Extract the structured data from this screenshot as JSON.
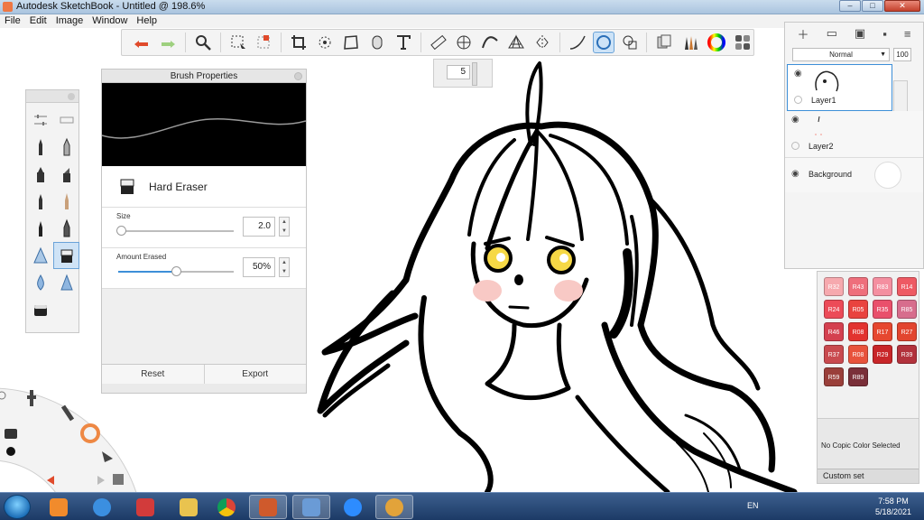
{
  "window": {
    "title": "Autodesk SketchBook - Untitled @ 198.6%",
    "min": "–",
    "max": "□",
    "close": "✕"
  },
  "menu": [
    "File",
    "Edit",
    "Image",
    "Window",
    "Help"
  ],
  "toolbar": {
    "tools": [
      "undo-icon",
      "redo-icon",
      "zoom-icon",
      "select-icon",
      "lasso-icon",
      "crop-icon",
      "transform-icon",
      "distort-icon",
      "fill-icon",
      "text-icon",
      "ruler-icon",
      "ellipse-icon",
      "curve-icon",
      "perspective-icon",
      "symmetry-icon",
      "stroke-icon",
      "predictive-icon",
      "shape-icon",
      "copy-icon",
      "brushes-icon",
      "color-wheel-icon",
      "palettes-icon"
    ],
    "active_tool": "predictive-icon"
  },
  "size_popup": {
    "value": "5"
  },
  "brush_properties": {
    "title": "Brush Properties",
    "brush_name": "Hard Eraser",
    "size": {
      "label": "Size",
      "value": "2.0",
      "fraction": 0.02
    },
    "amount": {
      "label": "Amount Erased",
      "value": "50%",
      "fraction": 0.5
    },
    "reset_label": "Reset",
    "export_label": "Export"
  },
  "layers": {
    "blend_mode": "Normal",
    "opacity": "100",
    "items": [
      {
        "name": "Layer1",
        "selected": true
      },
      {
        "name": "Layer2",
        "selected": false
      }
    ],
    "background_label": "Background"
  },
  "copic": {
    "swatches": [
      {
        "code": "R32",
        "color": "#f6a9ae"
      },
      {
        "code": "R43",
        "color": "#ee6f7c"
      },
      {
        "code": "R83",
        "color": "#f48fa0"
      },
      {
        "code": "R14",
        "color": "#ee5a63"
      },
      {
        "code": "R24",
        "color": "#ec4b58"
      },
      {
        "code": "R05",
        "color": "#e9433f"
      },
      {
        "code": "R35",
        "color": "#e9506b"
      },
      {
        "code": "R85",
        "color": "#d76d8d"
      },
      {
        "code": "R46",
        "color": "#d4404f"
      },
      {
        "code": "R08",
        "color": "#e2332f"
      },
      {
        "code": "R17",
        "color": "#e6472f"
      },
      {
        "code": "R27",
        "color": "#e2452f"
      },
      {
        "code": "R37",
        "color": "#c94a4f"
      },
      {
        "code": "R08b",
        "color": "#e8533c"
      },
      {
        "code": "R29",
        "color": "#c82629"
      },
      {
        "code": "R39",
        "color": "#b2323c"
      },
      {
        "code": "R59",
        "color": "#9a3f3a"
      },
      {
        "code": "R89",
        "color": "#7a2f39"
      }
    ],
    "status": "No Copic Color Selected",
    "set_label": "Custom set"
  },
  "taskbar": {
    "lang": "EN",
    "time": "7:58 PM",
    "date": "5/18/2021"
  }
}
